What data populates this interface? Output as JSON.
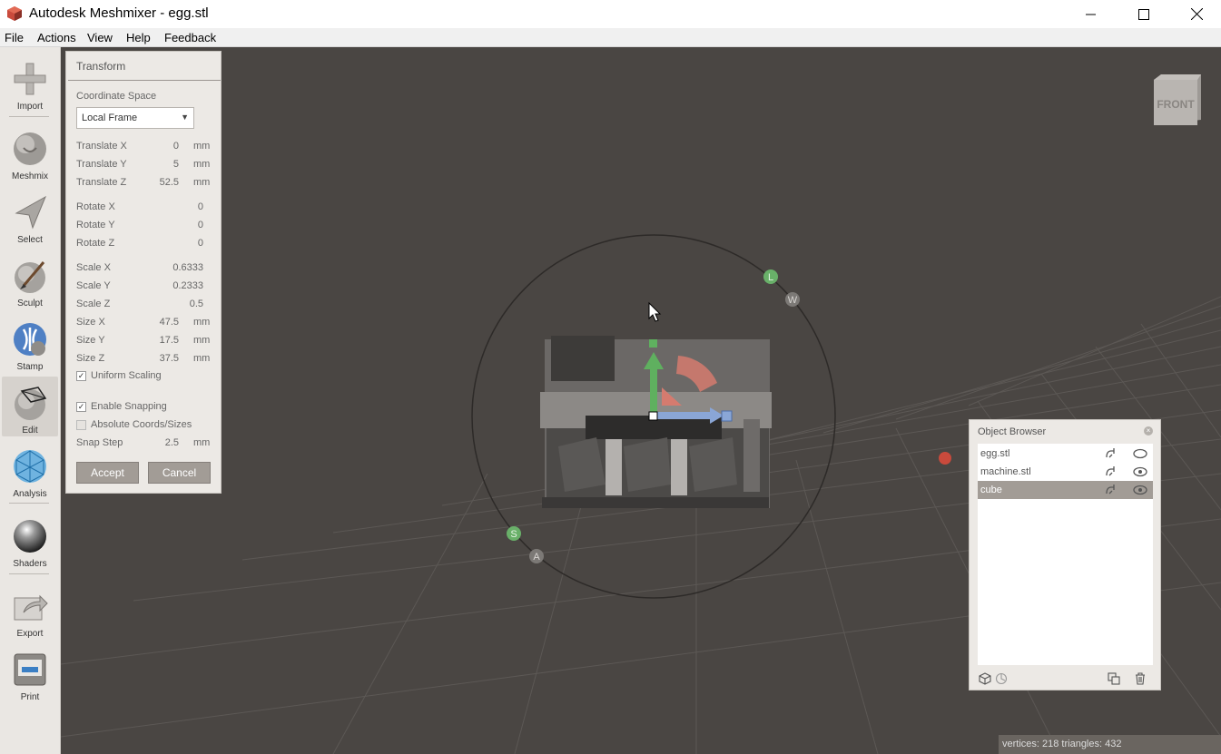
{
  "window": {
    "title": "Autodesk Meshmixer - egg.stl"
  },
  "menu": [
    "File",
    "Actions",
    "View",
    "Help",
    "Feedback"
  ],
  "toolbar": {
    "tools": [
      {
        "id": "import",
        "label": "Import"
      },
      {
        "id": "meshmix",
        "label": "Meshmix"
      },
      {
        "id": "select",
        "label": "Select"
      },
      {
        "id": "sculpt",
        "label": "Sculpt"
      },
      {
        "id": "stamp",
        "label": "Stamp"
      },
      {
        "id": "edit",
        "label": "Edit"
      },
      {
        "id": "analysis",
        "label": "Analysis"
      },
      {
        "id": "shaders",
        "label": "Shaders"
      },
      {
        "id": "export",
        "label": "Export"
      },
      {
        "id": "print",
        "label": "Print"
      }
    ],
    "active": "edit"
  },
  "transform": {
    "title": "Transform",
    "coord_space_label": "Coordinate Space",
    "coord_space_value": "Local Frame",
    "translate_x": {
      "label": "Translate X",
      "value": "0",
      "unit": "mm"
    },
    "translate_y": {
      "label": "Translate Y",
      "value": "5",
      "unit": "mm"
    },
    "translate_z": {
      "label": "Translate Z",
      "value": "52.5",
      "unit": "mm"
    },
    "rotate_x": {
      "label": "Rotate X",
      "value": "0"
    },
    "rotate_y": {
      "label": "Rotate Y",
      "value": "0"
    },
    "rotate_z": {
      "label": "Rotate Z",
      "value": "0"
    },
    "scale_x": {
      "label": "Scale X",
      "value": "0.6333"
    },
    "scale_y": {
      "label": "Scale Y",
      "value": "0.2333"
    },
    "scale_z": {
      "label": "Scale Z",
      "value": "0.5"
    },
    "size_x": {
      "label": "Size X",
      "value": "47.5",
      "unit": "mm"
    },
    "size_y": {
      "label": "Size Y",
      "value": "17.5",
      "unit": "mm"
    },
    "size_z": {
      "label": "Size Z",
      "value": "37.5",
      "unit": "mm"
    },
    "uniform_scaling": {
      "label": "Uniform Scaling",
      "checked": true
    },
    "enable_snapping": {
      "label": "Enable Snapping",
      "checked": true
    },
    "absolute_coords": {
      "label": "Absolute Coords/Sizes",
      "checked": false
    },
    "snap_step": {
      "label": "Snap Step",
      "value": "2.5",
      "unit": "mm"
    },
    "accept_label": "Accept",
    "cancel_label": "Cancel"
  },
  "object_browser": {
    "title": "Object Browser",
    "items": [
      {
        "name": "egg.stl",
        "selected": false
      },
      {
        "name": "machine.stl",
        "selected": false
      },
      {
        "name": "cube",
        "selected": true
      }
    ]
  },
  "viewcube": {
    "face_label": "FRONT"
  },
  "gizmo": {
    "labels": [
      "L",
      "W",
      "S",
      "A"
    ]
  },
  "status": {
    "text": "vertices: 218 triangles: 432"
  }
}
